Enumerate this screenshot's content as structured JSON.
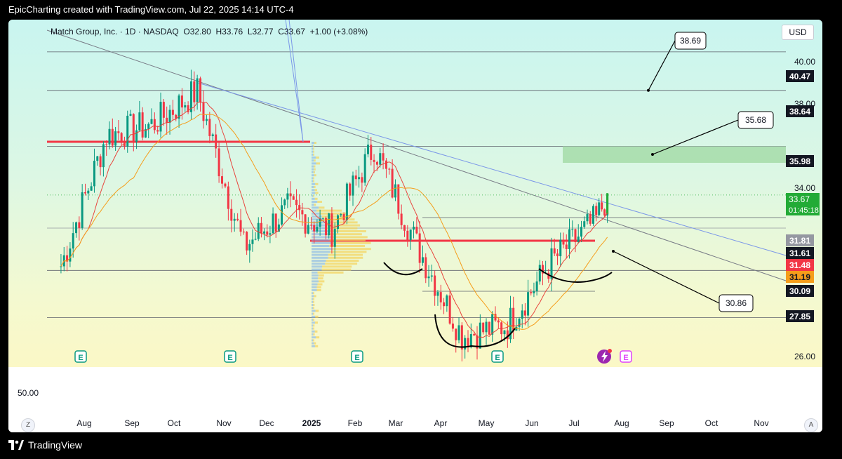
{
  "header": {
    "credit": "EpicCharting created with TradingView.com, Jul 22, 2025 14:14 UTC-4"
  },
  "legend": {
    "symbol": "Match Group, Inc. · 1D · NASDAQ",
    "open": "O32.80",
    "high": "H33.76",
    "low": "L32.77",
    "close": "C33.67",
    "change": "+1.00 (+3.08%)"
  },
  "currency_button": "USD",
  "lower_pane_label": "50.00",
  "footer": {
    "brand": "TradingView",
    "zoom_left": "Z",
    "zoom_right": "A"
  },
  "colors": {
    "support_line": "#f23645",
    "ma_fast": "#e8453c",
    "ma_slow": "#f59d1a",
    "trend_line": "#7b97e8",
    "candle_up": "#089981",
    "candle_down": "#f23645",
    "price_badge": "#22ab36",
    "target_zone": "#a5dca8",
    "earnings_icon": "#089981"
  },
  "chart_data": {
    "type": "candlestick",
    "symbol": "MTCH",
    "x_axis": {
      "ticks": [
        "Aug",
        "Sep",
        "Oct",
        "Nov",
        "Dec",
        "2025",
        "Feb",
        "Mar",
        "Apr",
        "May",
        "Jun",
        "Jul",
        "Aug",
        "Sep",
        "Oct",
        "Nov"
      ]
    },
    "y_axis": {
      "tick_labels": [
        "40.00",
        "38.00",
        "34.00",
        "26.00"
      ],
      "range": [
        25.5,
        42
      ]
    },
    "price_levels": [
      "40.47",
      "38.64",
      "35.98",
      "31.81",
      "31.61",
      "31.48",
      "31.19",
      "30.09",
      "27.85"
    ],
    "current_price": {
      "value": "33.67",
      "countdown": "01:45:18"
    },
    "callouts": [
      "38.69",
      "35.68",
      "30.86"
    ],
    "earnings_markers": [
      "E",
      "E",
      "E",
      "E",
      "E"
    ],
    "ohlc_close_path": [
      {
        "x": "Jul 2024",
        "y": 30.3
      },
      {
        "x": "Aug 2024",
        "y": 36.5
      },
      {
        "x": "Sep 2024",
        "y": 37.0
      },
      {
        "x": "Oct 2024",
        "y": 38.6
      },
      {
        "x": "Nov 2024",
        "y": 31.2
      },
      {
        "x": "Dec 2024",
        "y": 33.0
      },
      {
        "x": "Jan 2025",
        "y": 32.0
      },
      {
        "x": "Feb 2025",
        "y": 36.0
      },
      {
        "x": "Mar 2025",
        "y": 31.3
      },
      {
        "x": "Apr 2025",
        "y": 27.0
      },
      {
        "x": "May 2025",
        "y": 27.5
      },
      {
        "x": "Jun 2025",
        "y": 30.5
      },
      {
        "x": "Jul 2025",
        "y": 32.5
      },
      {
        "x": "Jul 22 2025",
        "y": 33.67
      }
    ]
  }
}
